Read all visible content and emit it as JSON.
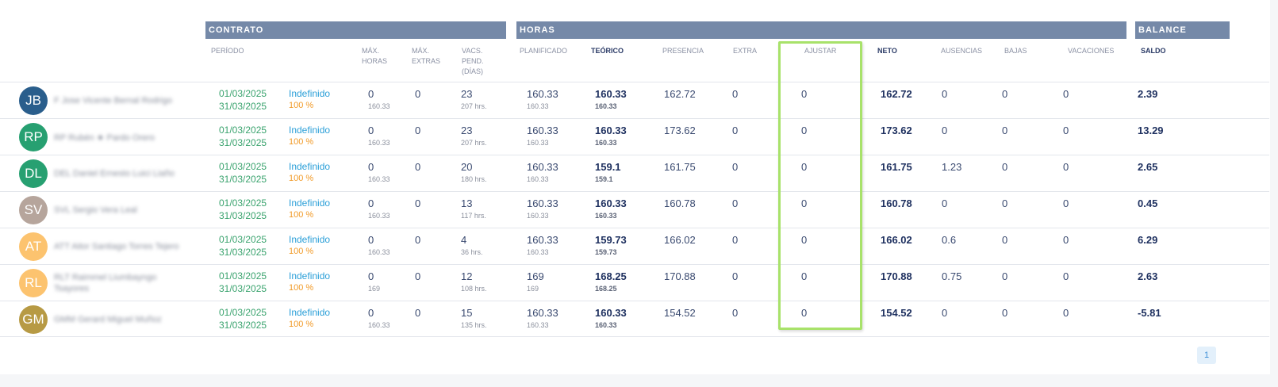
{
  "sections": {
    "contrato": "CONTRATO",
    "horas": "HORAS",
    "balance": "BALANCE"
  },
  "columns": {
    "periodo": "PERÍODO",
    "max_horas": [
      "MÁX.",
      "HORAS"
    ],
    "max_extras": [
      "MÁX.",
      "EXTRAS"
    ],
    "vacs_pend": [
      "VACS.",
      "PEND.",
      "(DÍAS)"
    ],
    "planificado": "PLANIFICADO",
    "teorico": "TEÓRICO",
    "presencia": "PRESENCIA",
    "extra": "EXTRA",
    "ajustar": "AJUSTAR",
    "neto": "NETO",
    "ausencias": "AUSENCIAS",
    "bajas": "BAJAS",
    "vacaciones": "VACACIONES",
    "saldo": "SALDO"
  },
  "rows": [
    {
      "initials": "JB",
      "avatar_color": "#2a5e8c",
      "name": "F Jose Vicente Bernal Rodrigo",
      "start": "01/03/2025",
      "end": "31/03/2025",
      "contract": "Indefinido",
      "pct": "100 %",
      "max_horas": "0",
      "max_horas_sub": "160.33",
      "max_extras": "0",
      "vacs": "23",
      "vacs_sub": "207 hrs.",
      "planificado": "160.33",
      "planificado_sub": "160.33",
      "teorico": "160.33",
      "teorico_sub": "160.33",
      "presencia": "162.72",
      "extra": "0",
      "ajustar": "0",
      "neto": "162.72",
      "ausencias": "0",
      "bajas": "0",
      "vacaciones": "0",
      "saldo": "2.39"
    },
    {
      "initials": "RP",
      "avatar_color": "#27a071",
      "name": "RP Rubén ★ Pardo Orero",
      "start": "01/03/2025",
      "end": "31/03/2025",
      "contract": "Indefinido",
      "pct": "100 %",
      "max_horas": "0",
      "max_horas_sub": "160.33",
      "max_extras": "0",
      "vacs": "23",
      "vacs_sub": "207 hrs.",
      "planificado": "160.33",
      "planificado_sub": "160.33",
      "teorico": "160.33",
      "teorico_sub": "160.33",
      "presencia": "173.62",
      "extra": "0",
      "ajustar": "0",
      "neto": "173.62",
      "ausencias": "0",
      "bajas": "0",
      "vacaciones": "0",
      "saldo": "13.29"
    },
    {
      "initials": "DL",
      "avatar_color": "#27a071",
      "name": "DEL Daniel Ernesto Luici Liaño",
      "start": "01/03/2025",
      "end": "31/03/2025",
      "contract": "Indefinido",
      "pct": "100 %",
      "max_horas": "0",
      "max_horas_sub": "160.33",
      "max_extras": "0",
      "vacs": "20",
      "vacs_sub": "180 hrs.",
      "planificado": "160.33",
      "planificado_sub": "160.33",
      "teorico": "159.1",
      "teorico_sub": "159.1",
      "presencia": "161.75",
      "extra": "0",
      "ajustar": "0",
      "neto": "161.75",
      "ausencias": "1.23",
      "bajas": "0",
      "vacaciones": "0",
      "saldo": "2.65"
    },
    {
      "initials": "SV",
      "avatar_color": "#b6a59c",
      "name": "SVL Sergio Vera Leal",
      "start": "01/03/2025",
      "end": "31/03/2025",
      "contract": "Indefinido",
      "pct": "100 %",
      "max_horas": "0",
      "max_horas_sub": "160.33",
      "max_extras": "0",
      "vacs": "13",
      "vacs_sub": "117 hrs.",
      "planificado": "160.33",
      "planificado_sub": "160.33",
      "teorico": "160.33",
      "teorico_sub": "160.33",
      "presencia": "160.78",
      "extra": "0",
      "ajustar": "0",
      "neto": "160.78",
      "ausencias": "0",
      "bajas": "0",
      "vacaciones": "0",
      "saldo": "0.45"
    },
    {
      "initials": "AT",
      "avatar_color": "#fcc36f",
      "name": "ATT Aitor Santiago Torres Tejero",
      "start": "01/03/2025",
      "end": "31/03/2025",
      "contract": "Indefinido",
      "pct": "100 %",
      "max_horas": "0",
      "max_horas_sub": "160.33",
      "max_extras": "0",
      "vacs": "4",
      "vacs_sub": "36 hrs.",
      "planificado": "160.33",
      "planificado_sub": "160.33",
      "teorico": "159.73",
      "teorico_sub": "159.73",
      "presencia": "166.02",
      "extra": "0",
      "ajustar": "0",
      "neto": "166.02",
      "ausencias": "0.6",
      "bajas": "0",
      "vacaciones": "0",
      "saldo": "6.29"
    },
    {
      "initials": "RL",
      "avatar_color": "#fcc36f",
      "name": "RLT Raimmel Liumbayngo",
      "name2": "Tsayores",
      "start": "01/03/2025",
      "end": "31/03/2025",
      "contract": "Indefinido",
      "pct": "100 %",
      "max_horas": "0",
      "max_horas_sub": "169",
      "max_extras": "0",
      "vacs": "12",
      "vacs_sub": "108 hrs.",
      "planificado": "169",
      "planificado_sub": "169",
      "teorico": "168.25",
      "teorico_sub": "168.25",
      "presencia": "170.88",
      "extra": "0",
      "ajustar": "0",
      "neto": "170.88",
      "ausencias": "0.75",
      "bajas": "0",
      "vacaciones": "0",
      "saldo": "2.63"
    },
    {
      "initials": "GM",
      "avatar_color": "#b79a44",
      "name": "GMM Gerard Miguel Muñoz",
      "start": "01/03/2025",
      "end": "31/03/2025",
      "contract": "Indefinido",
      "pct": "100 %",
      "max_horas": "0",
      "max_horas_sub": "160.33",
      "max_extras": "0",
      "vacs": "15",
      "vacs_sub": "135 hrs.",
      "planificado": "160.33",
      "planificado_sub": "160.33",
      "teorico": "160.33",
      "teorico_sub": "160.33",
      "presencia": "154.52",
      "extra": "0",
      "ajustar": "0",
      "neto": "154.52",
      "ausencias": "0",
      "bajas": "0",
      "vacaciones": "0",
      "saldo": "-5.81"
    }
  ],
  "pagination": {
    "current_page": "1"
  }
}
